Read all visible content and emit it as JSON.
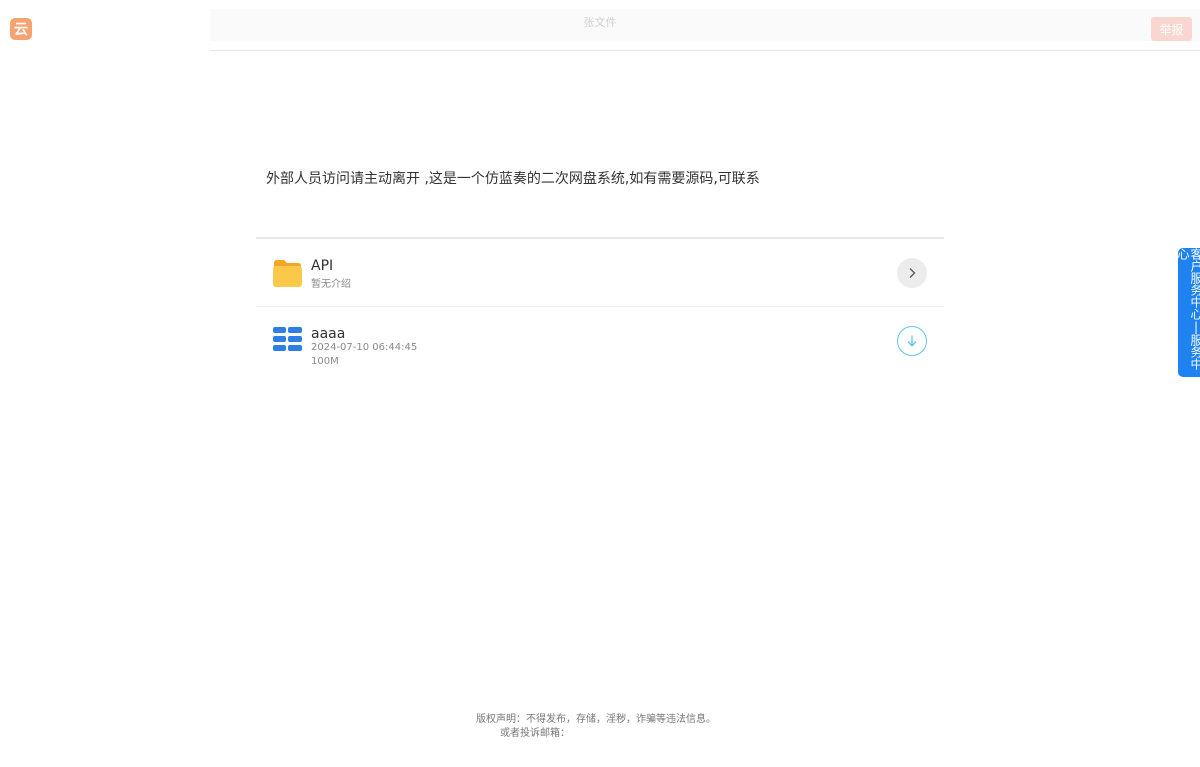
{
  "header": {
    "logo_text": "云",
    "title": "张文件",
    "report_label": "举报"
  },
  "notice": "外部人员访问请主动离开 ,这是一个仿蓝奏的二次网盘系统,如有需要源码,可联系",
  "files": [
    {
      "type": "folder",
      "name": "API",
      "description": "暂无介绍",
      "action_icon": "chevron-right-icon"
    },
    {
      "type": "file",
      "name": "aaaa",
      "date": "2024-07-10 06:44:45",
      "size": "100M",
      "action_icon": "download-icon"
    }
  ],
  "side_tab": "客户服务中心|服务中心",
  "footer": {
    "line1": "版权声明：不得发布，存储，淫秽，诈骗等违法信息。",
    "line2": "或者投诉邮箱："
  },
  "colors": {
    "logo": "#f7a271",
    "report_button": "#f9d6cf",
    "side_tab": "#1e82f0",
    "download_ring": "#5cc4ea",
    "folder": "#fbc94a"
  }
}
